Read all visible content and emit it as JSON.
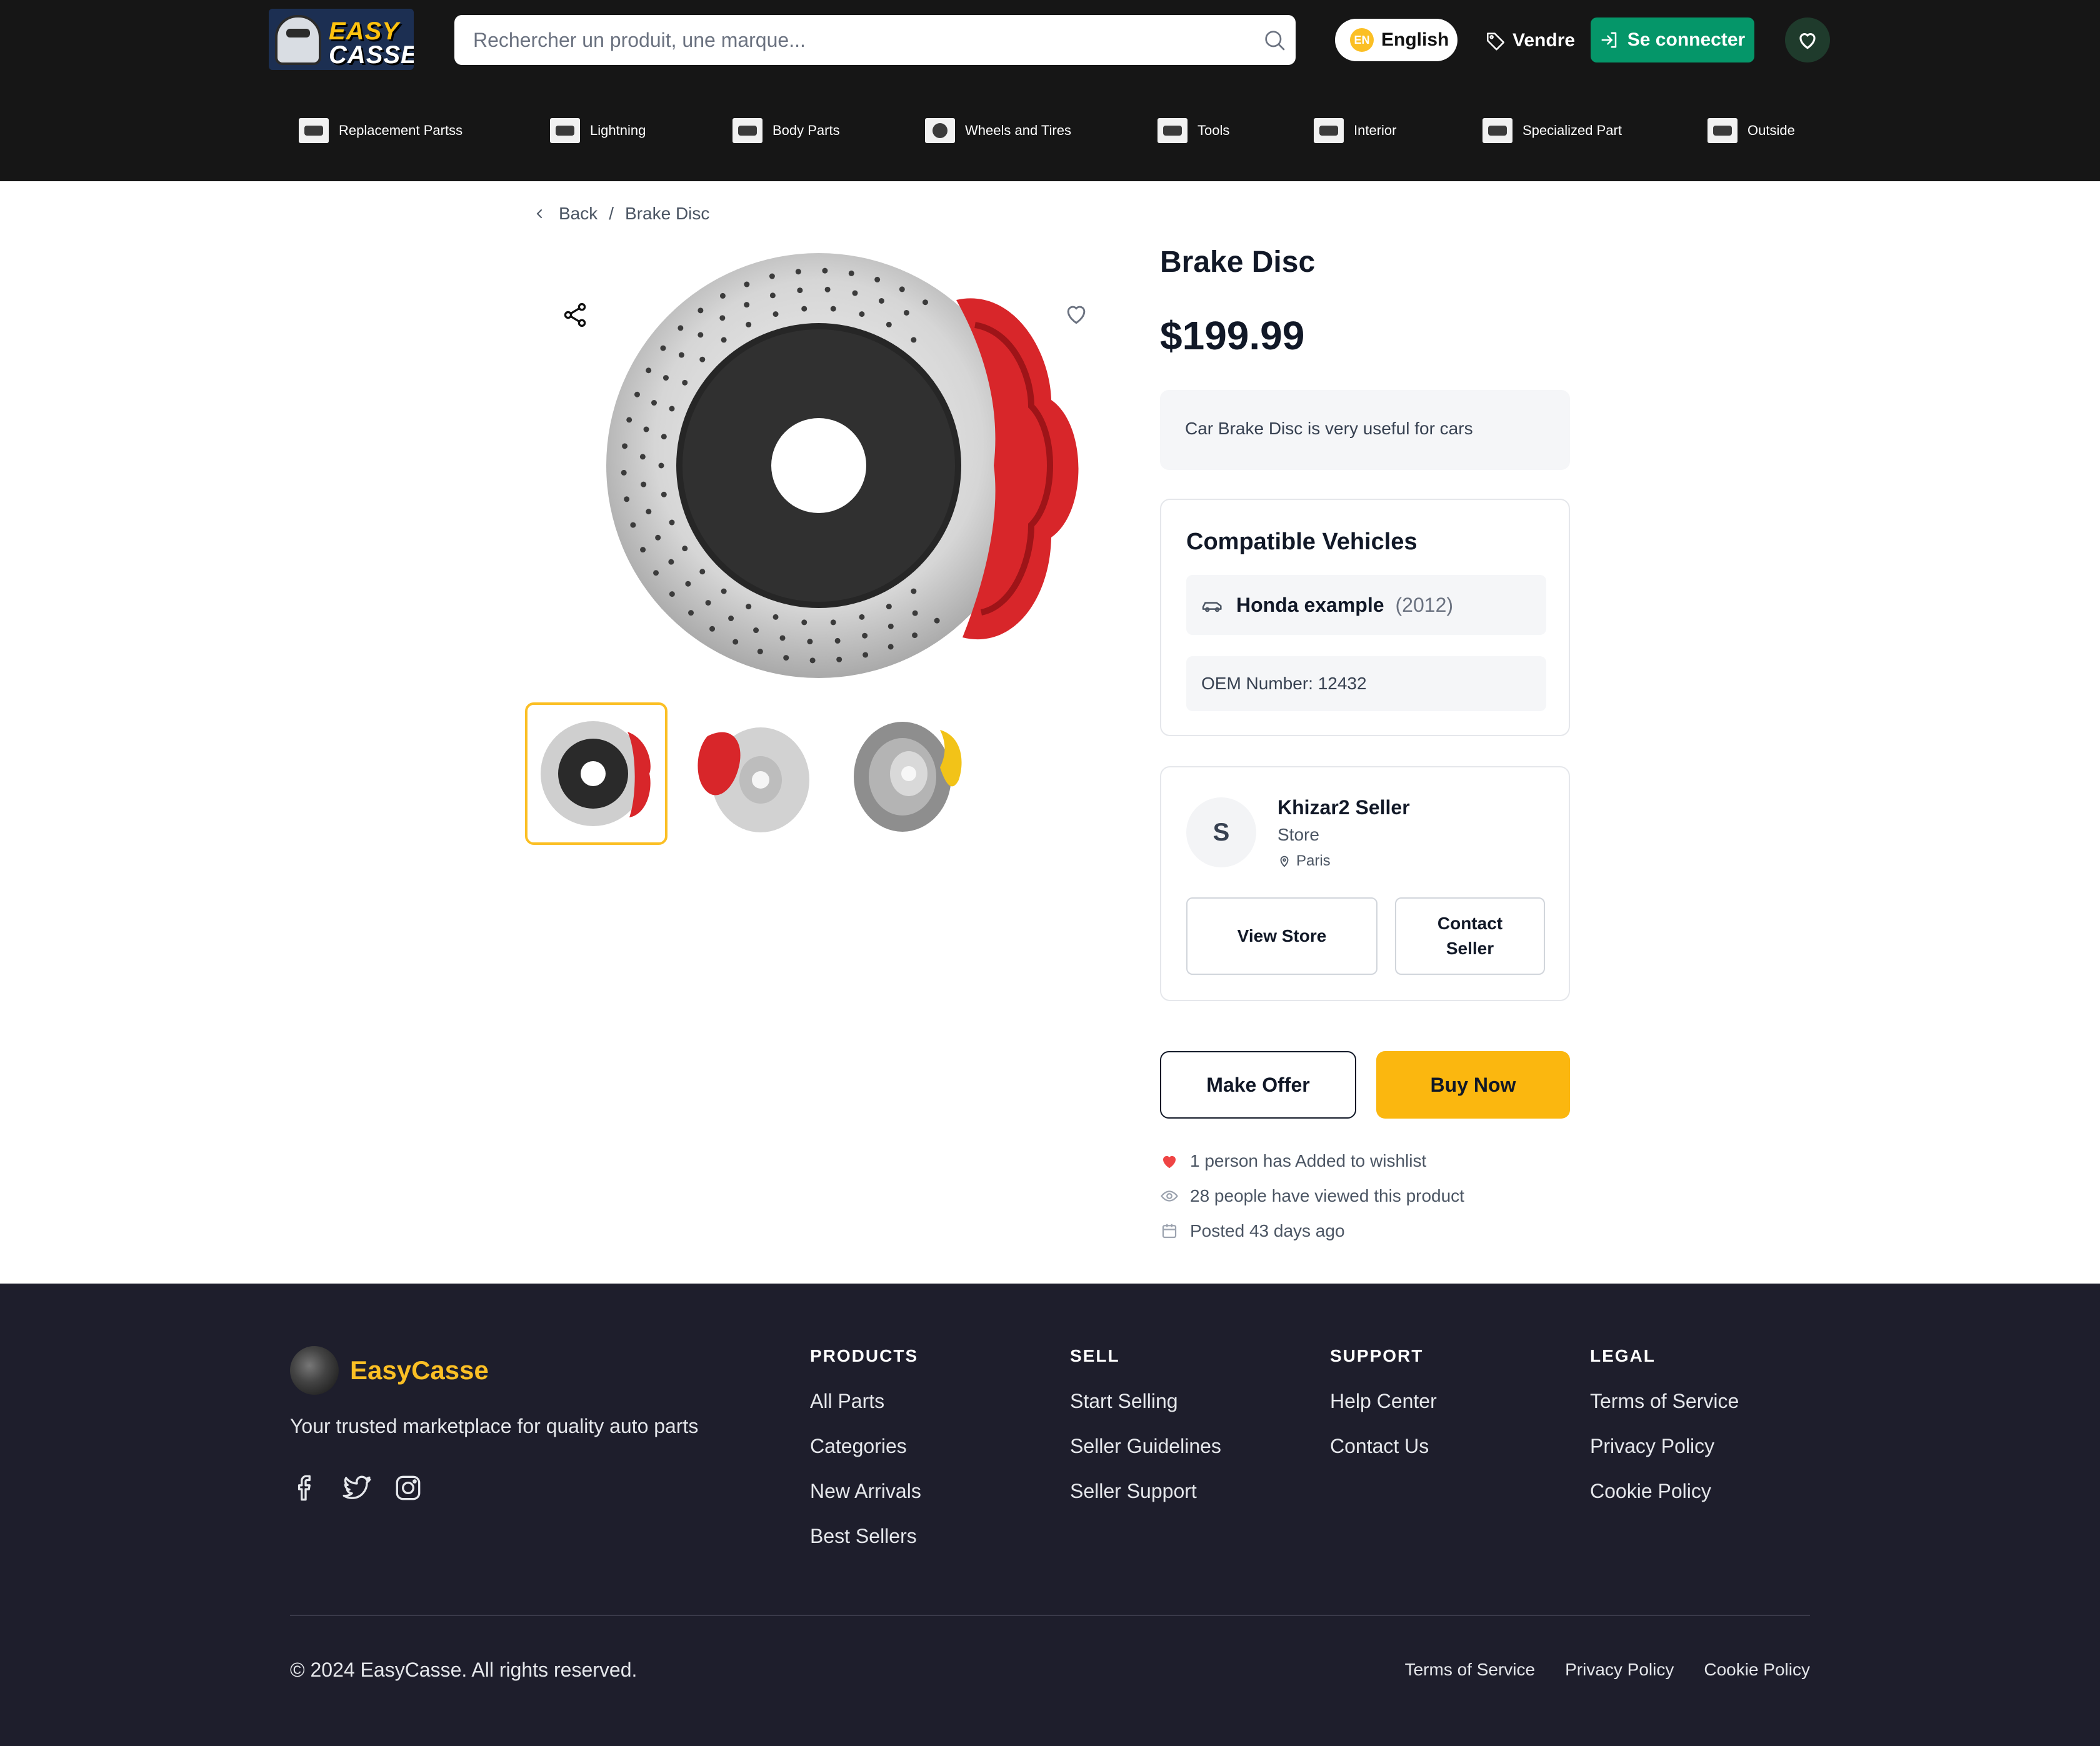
{
  "header": {
    "logo_line1": "EASY",
    "logo_line2": "CASSE",
    "search_placeholder": "Rechercher un produit, une marque...",
    "language_code": "EN",
    "language_label": "English",
    "sell_label": "Vendre",
    "login_label": "Se connecter",
    "accent_color": "#059669"
  },
  "categories": [
    {
      "label": "Replacement Partss",
      "icon": "engine-part-icon"
    },
    {
      "label": "Lightning",
      "icon": "headlight-icon"
    },
    {
      "label": "Body Parts",
      "icon": "car-body-icon"
    },
    {
      "label": "Wheels and Tires",
      "icon": "wheel-icon"
    },
    {
      "label": "Tools",
      "icon": "tools-icon"
    },
    {
      "label": "Interior",
      "icon": "seat-icon"
    },
    {
      "label": "Specialized Part",
      "icon": "specialized-part-icon"
    },
    {
      "label": "Outside",
      "icon": "car-exterior-icon"
    }
  ],
  "breadcrumb": {
    "back_label": "Back",
    "separator": "/",
    "current": "Brake Disc"
  },
  "product": {
    "title": "Brake Disc",
    "price": "$199.99",
    "description": "Car Brake Disc is very useful for cars",
    "compatible_title": "Compatible Vehicles",
    "vehicle_name": "Honda example",
    "vehicle_year": "(2012)",
    "oem": "OEM Number: 12432",
    "thumbnails": [
      "brake-disc-red-caliper-front",
      "brake-disc-red-caliper-angle",
      "brake-disc-yellow-caliper"
    ],
    "selected_thumbnail": 0
  },
  "seller": {
    "initial": "S",
    "name": "Khizar2 Seller",
    "type": "Store",
    "location": "Paris",
    "view_store_label": "View Store",
    "contact_label": "Contact Seller"
  },
  "actions": {
    "offer_label": "Make Offer",
    "buy_label": "Buy Now",
    "buy_color": "#fbb70f"
  },
  "stats": {
    "wishlist": "1 person has Added to wishlist",
    "views": "28 people have viewed this product",
    "posted": "Posted 43 days ago"
  },
  "footer": {
    "brand": "EasyCasse",
    "tagline": "Your trusted marketplace for quality auto parts",
    "columns": [
      {
        "title": "PRODUCTS",
        "links": [
          "All Parts",
          "Categories",
          "New Arrivals",
          "Best Sellers"
        ]
      },
      {
        "title": "SELL",
        "links": [
          "Start Selling",
          "Seller Guidelines",
          "Seller Support"
        ]
      },
      {
        "title": "SUPPORT",
        "links": [
          "Help Center",
          "Contact Us"
        ]
      },
      {
        "title": "LEGAL",
        "links": [
          "Terms of Service",
          "Privacy Policy",
          "Cookie Policy"
        ]
      }
    ],
    "copyright": "© 2024 EasyCasse. All rights reserved.",
    "bottom_links": [
      "Terms of Service",
      "Privacy Policy",
      "Cookie Policy"
    ],
    "brand_color": "#fbbf24"
  }
}
